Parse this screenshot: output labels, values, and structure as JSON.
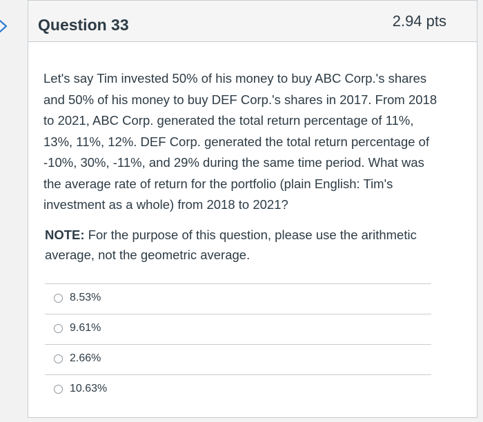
{
  "question": {
    "title": "Question 33",
    "points": "2.94 pts",
    "body": "Let's say Tim invested 50% of his money to buy ABC Corp.'s shares and 50% of his money to buy DEF Corp.'s shares in 2017. From 2018 to 2021, ABC Corp. generated the total return percentage of 11%, 13%, 11%, 12%. DEF Corp. generated the total return percentage of -10%, 30%, -11%, and 29% during the same time period. What was the average rate of return for the portfolio (plain English: Tim's investment as a whole) from 2018 to 2021?",
    "note_label": "NOTE:",
    "note_text": " For the purpose of this question, please use the arithmetic average, not the geometric average."
  },
  "answers": [
    {
      "label": "8.53%"
    },
    {
      "label": "9.61%"
    },
    {
      "label": "2.66%"
    },
    {
      "label": "10.63%"
    }
  ],
  "icons": {
    "edge": "chevron-right-icon"
  },
  "colors": {
    "text": "#2d3b45",
    "border": "#c7cdd1",
    "header_bg": "#f5f5f5",
    "chevron": "#2d7dd2"
  }
}
